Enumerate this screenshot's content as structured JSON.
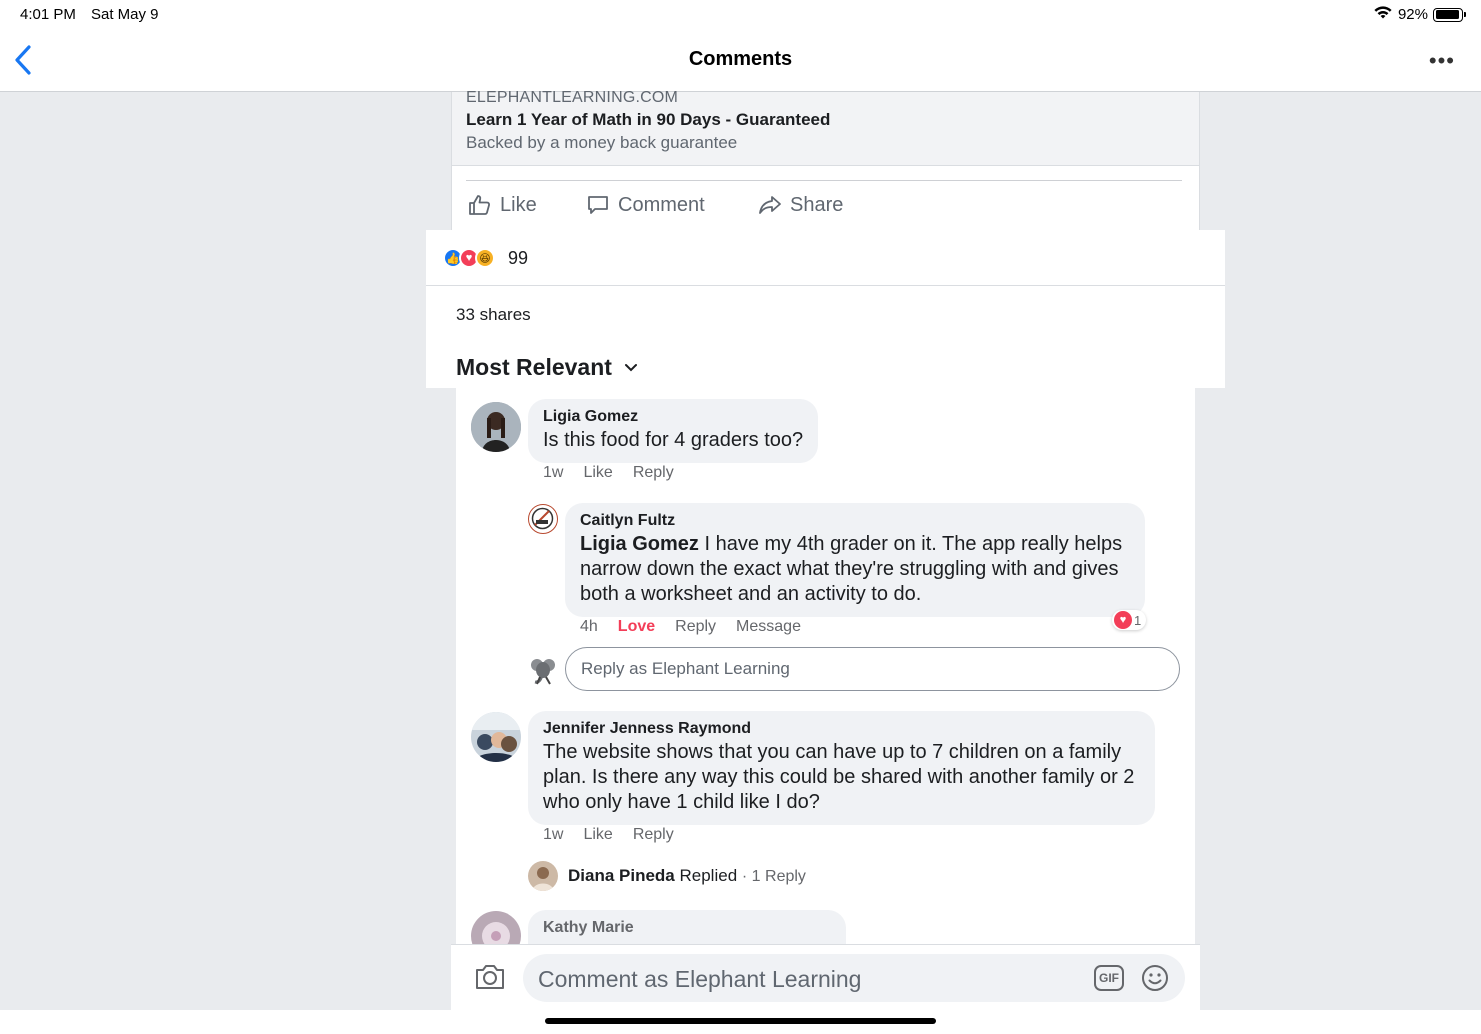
{
  "status_bar": {
    "time": "4:01 PM",
    "date": "Sat May 9",
    "battery": "92%",
    "battery_level": 0.92
  },
  "nav": {
    "title": "Comments",
    "more": "•••"
  },
  "post": {
    "link": {
      "domain": "ELEPHANTLEARNING.COM",
      "title": "Learn 1 Year of Math in 90 Days - Guaranteed",
      "description": "Backed by a money back guarantee"
    },
    "actions": {
      "like": "Like",
      "comment": "Comment",
      "share": "Share"
    },
    "reactions": {
      "icons": [
        "like-icon",
        "love-icon",
        "haha-icon"
      ],
      "count": "99"
    },
    "shares": "33 shares",
    "sort": "Most Relevant"
  },
  "comments": [
    {
      "name": "Ligia Gomez",
      "text": "Is this food for 4 graders too?",
      "time": "1w",
      "like": "Like",
      "reply": "Reply",
      "replies": [
        {
          "name": "Caitlyn Fultz",
          "mention": "Ligia Gomez",
          "text": " I have my 4th grader on it. The app really helps narrow down the exact what they're struggling with and gives both a worksheet and an activity to do.",
          "time": "4h",
          "love": "Love",
          "reply": "Reply",
          "message": "Message",
          "reaction_count": "1"
        }
      ],
      "reply_placeholder": "Reply as Elephant Learning"
    },
    {
      "name": "Jennifer Jenness Raymond",
      "text": "The website shows that you can have up to 7 children on a family plan. Is there any way this could be shared with another family or 2 who only have 1 child like I do?",
      "time": "1w",
      "like": "Like",
      "reply": "Reply",
      "replied_by": {
        "name": "Diana Pineda",
        "label": "Replied",
        "count": "· 1 Reply"
      }
    },
    {
      "name": "Kathy Marie"
    }
  ],
  "composer": {
    "placeholder": "Comment as Elephant Learning",
    "gif": "GIF"
  },
  "colors": {
    "accent": "#1877f2",
    "love": "#f33e58",
    "bubble": "#f0f2f5",
    "background": "#e9ebee"
  }
}
